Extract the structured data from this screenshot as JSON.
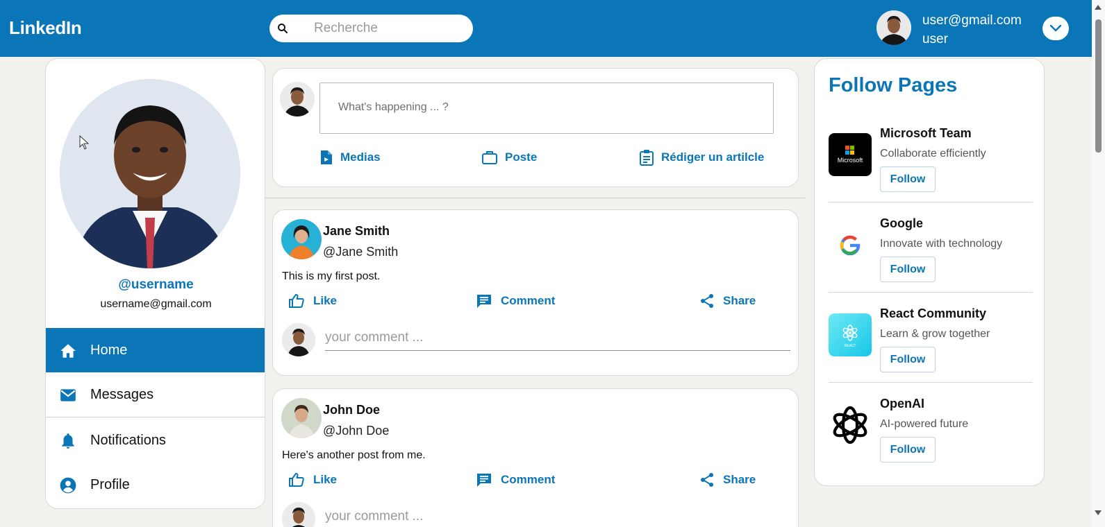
{
  "header": {
    "logo": "LinkedIn",
    "search_placeholder": "Recherche",
    "user_email": "user@gmail.com",
    "user_name": "user",
    "brand_color": "#0a76b7"
  },
  "sidebar": {
    "handle": "@username",
    "email": "username@gmail.com",
    "nav": [
      {
        "label": "Home",
        "icon": "home-icon",
        "active": true
      },
      {
        "label": "Messages",
        "icon": "mail-icon"
      },
      {
        "label": "Notifications",
        "icon": "bell-icon"
      },
      {
        "label": "Profile",
        "icon": "account-circle-icon"
      }
    ]
  },
  "composer": {
    "placeholder": "What's happening ... ?",
    "actions": [
      {
        "label": "Medias",
        "icon": "file-icon"
      },
      {
        "label": "Poste",
        "icon": "briefcase-icon"
      },
      {
        "label": "Rédiger un artilcle",
        "icon": "clipboard-icon"
      }
    ]
  },
  "posts": [
    {
      "name": "Jane Smith",
      "handle": "@Jane Smith",
      "text": "This is my first post.",
      "like_label": "Like",
      "comment_label": "Comment",
      "share_label": "Share",
      "comment_placeholder": "your comment ..."
    },
    {
      "name": "John Doe",
      "handle": "@John Doe",
      "text": "Here's another post from me.",
      "like_label": "Like",
      "comment_label": "Comment",
      "share_label": "Share",
      "comment_placeholder": "your comment ..."
    }
  ],
  "follow_pages": {
    "title": "Follow Pages",
    "pages": [
      {
        "name": "Microsoft Team",
        "desc": "Collaborate efficiently",
        "button": "Follow",
        "logo_text": "Microsoft"
      },
      {
        "name": "Google",
        "desc": "Innovate with technology",
        "button": "Follow"
      },
      {
        "name": "React Community",
        "desc": "Learn & grow together",
        "button": "Follow",
        "logo_text": "REACT"
      },
      {
        "name": "OpenAI",
        "desc": "AI-powered future",
        "button": "Follow"
      }
    ]
  }
}
